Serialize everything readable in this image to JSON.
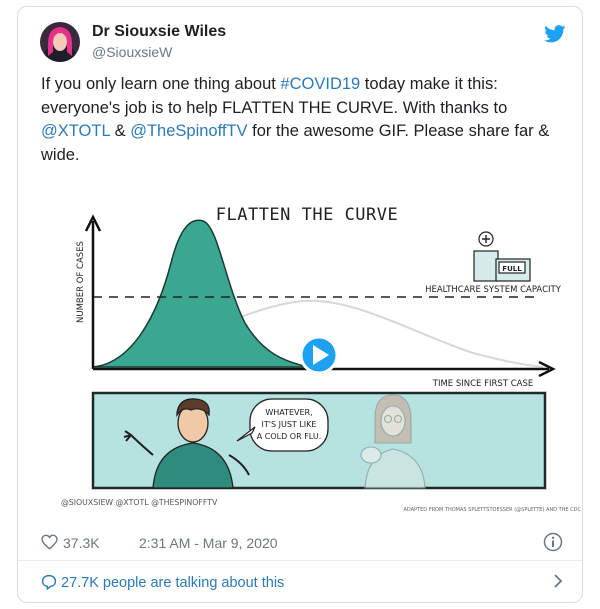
{
  "author": {
    "name": "Dr Siouxsie Wiles",
    "handle": "@SiouxsieW"
  },
  "tweet": {
    "text_1": "If you only learn one thing about ",
    "hashtag": "#COVID19",
    "text_2": " today make it this: everyone's job is to help FLATTEN THE CURVE. With thanks to ",
    "mention_1": "@XTOTL",
    "text_3": " & ",
    "mention_2": "@TheSpinoffTV",
    "text_4": " for the awesome GIF. Please share far & wide."
  },
  "media": {
    "title": "FLATTEN THE CURVE",
    "y_axis_label": "NUMBER OF CASES",
    "capacity_label": "HEALTHCARE SYSTEM CAPACITY",
    "hospital_sign": "FULL",
    "x_axis_label": "TIME SINCE FIRST CASE",
    "speech": [
      "WHATEVER,",
      "IT'S JUST LIKE",
      "A COLD OR FLU."
    ],
    "credits_left": "@SIOUXSIEW @XTOTL @THESPINOFFTV",
    "credits_right": "ADAPTED FROM THOMAS SPLETTSTOESSER (@SPLETTE) AND THE CDC"
  },
  "meta": {
    "likes": "37.3K",
    "timestamp": "2:31 AM - Mar 9, 2020"
  },
  "conversation": {
    "label": "27.7K people are talking about this"
  },
  "colors": {
    "link": "#2b7bb9",
    "curve_fill": "#3aa891",
    "panel_bg": "#b6e2df",
    "play_button": "#1da1f2"
  },
  "icons": [
    "twitter-bird-icon",
    "heart-icon",
    "info-icon",
    "speech-bubble-icon",
    "chevron-right-icon",
    "play-icon"
  ]
}
